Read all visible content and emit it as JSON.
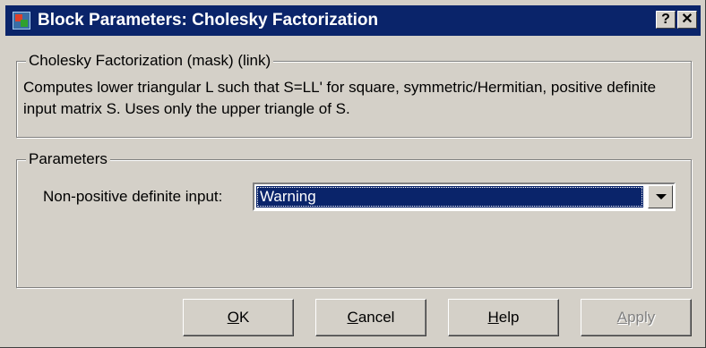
{
  "window": {
    "title": "Block Parameters: Cholesky Factorization",
    "help_glyph": "?",
    "close_glyph": "✕",
    "icon": "simulink-block-icon"
  },
  "mask_group": {
    "legend": "Cholesky Factorization (mask) (link)",
    "description": "Computes lower triangular L such that S=LL' for square, symmetric/Hermitian, positive definite input matrix S. Uses only the upper triangle of S."
  },
  "parameters_group": {
    "legend": "Parameters",
    "nonpositive_label": "Non-positive definite input:",
    "nonpositive_value": "Warning"
  },
  "buttons": {
    "ok": {
      "mnemonic": "O",
      "rest": "K"
    },
    "cancel": {
      "mnemonic": "C",
      "rest": "ancel"
    },
    "help": {
      "mnemonic": "H",
      "rest": "elp"
    },
    "apply": {
      "mnemonic": "A",
      "rest": "pply"
    }
  },
  "colors": {
    "titlebar": "#0a246a",
    "face": "#d4d0c8",
    "selection": "#0a246a"
  }
}
